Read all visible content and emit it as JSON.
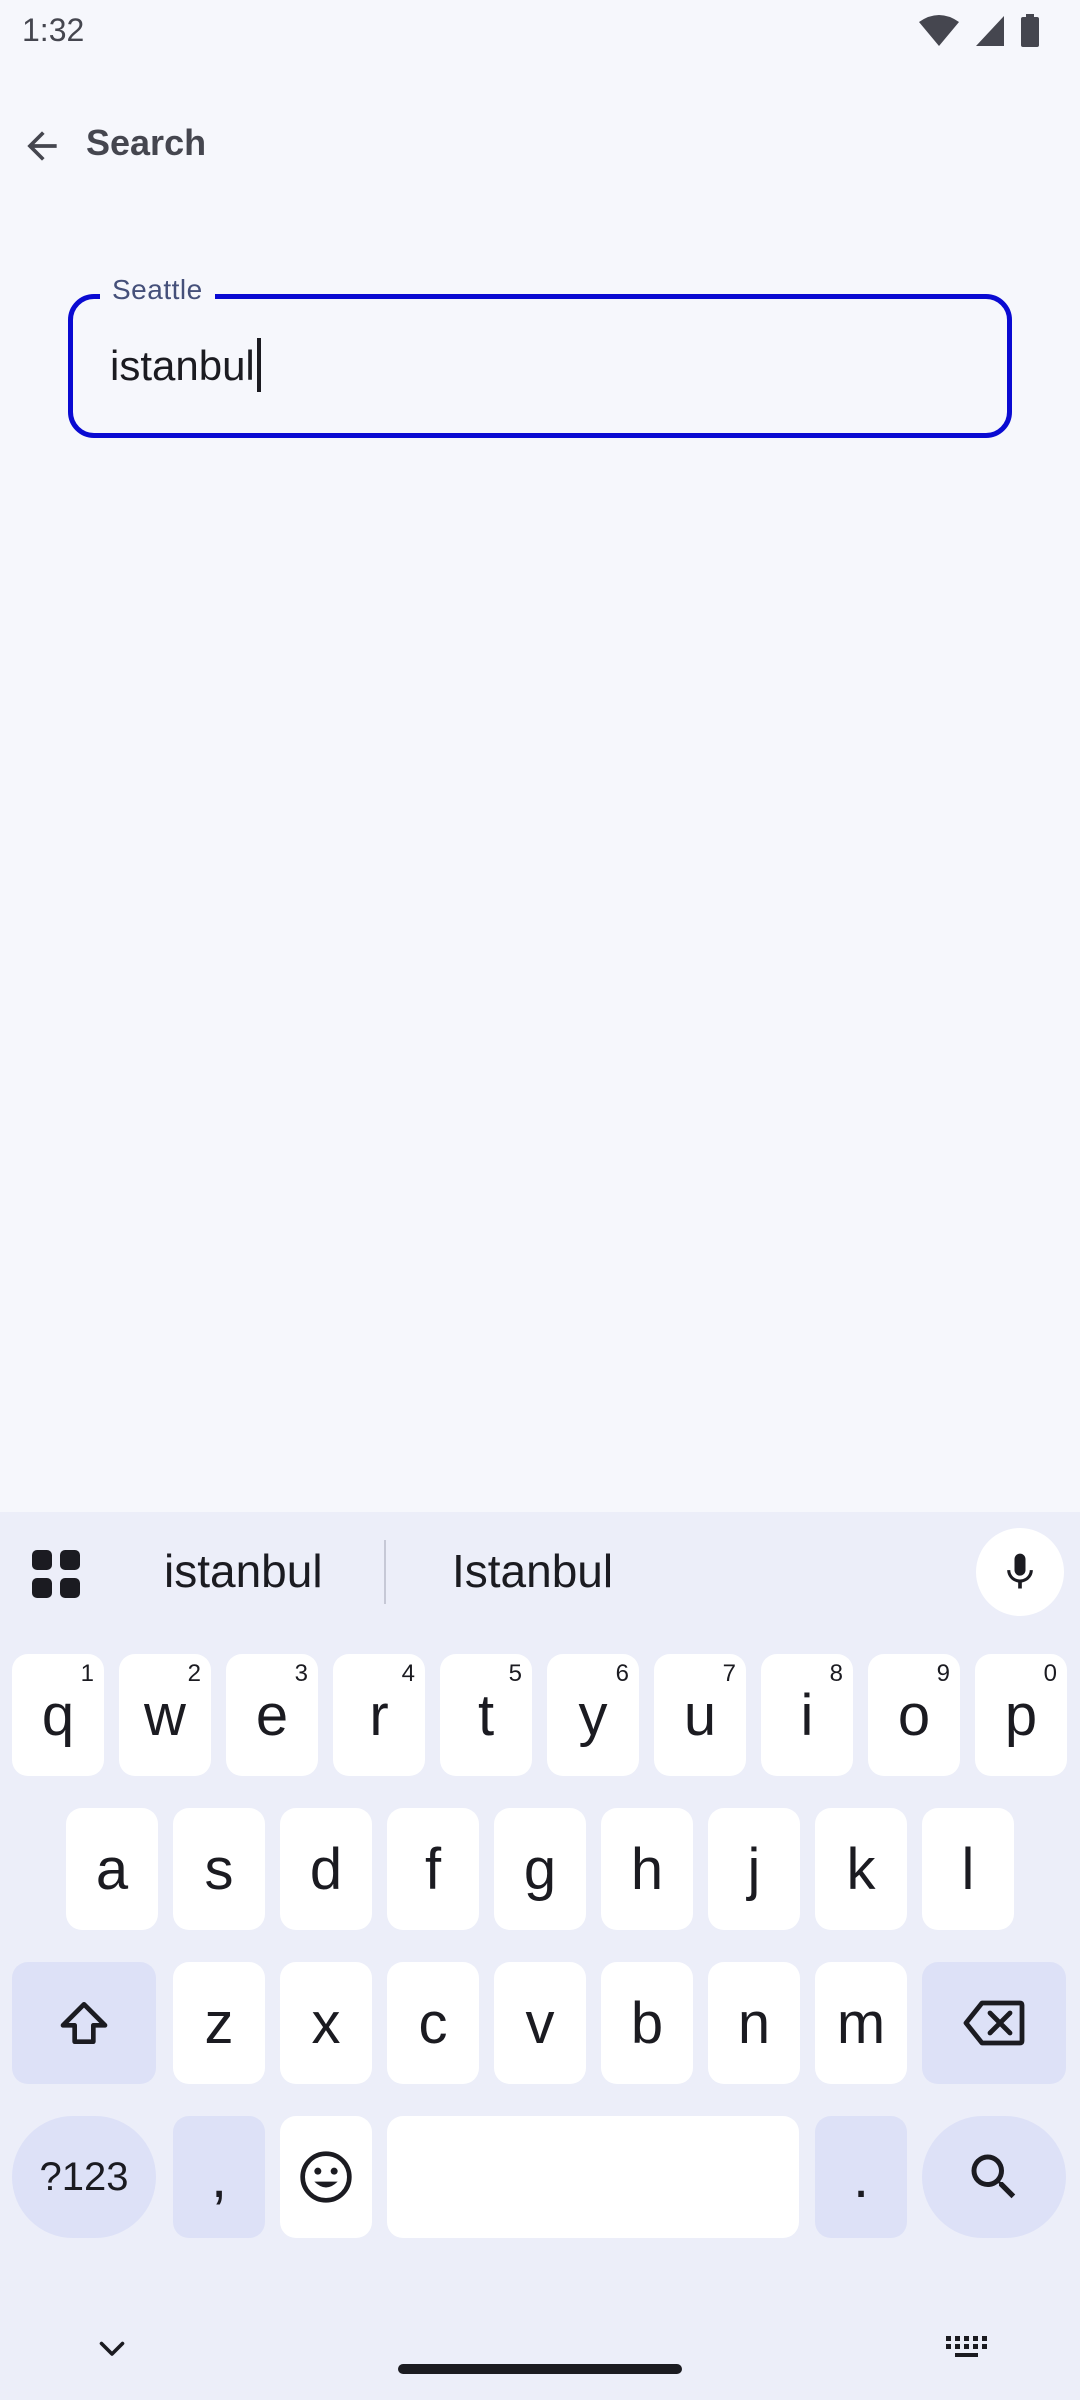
{
  "status": {
    "time": "1:32"
  },
  "header": {
    "title": "Search"
  },
  "search_field": {
    "label": "Seattle",
    "value": "istanbul"
  },
  "suggestions": [
    "istanbul",
    "Istanbul"
  ],
  "keyboard": {
    "row1": [
      {
        "k": "q",
        "h": "1"
      },
      {
        "k": "w",
        "h": "2"
      },
      {
        "k": "e",
        "h": "3"
      },
      {
        "k": "r",
        "h": "4"
      },
      {
        "k": "t",
        "h": "5"
      },
      {
        "k": "y",
        "h": "6"
      },
      {
        "k": "u",
        "h": "7"
      },
      {
        "k": "i",
        "h": "8"
      },
      {
        "k": "o",
        "h": "9"
      },
      {
        "k": "p",
        "h": "0"
      }
    ],
    "row2": [
      "a",
      "s",
      "d",
      "f",
      "g",
      "h",
      "j",
      "k",
      "l"
    ],
    "row3": [
      "z",
      "x",
      "c",
      "v",
      "b",
      "n",
      "m"
    ],
    "symbols_label": "?123",
    "comma": ",",
    "period": "."
  },
  "colors": {
    "accent": "#0a0ad2",
    "background": "#f6f7fc",
    "keyboard_bg": "#eceef9",
    "special_key": "#dde1f7"
  }
}
